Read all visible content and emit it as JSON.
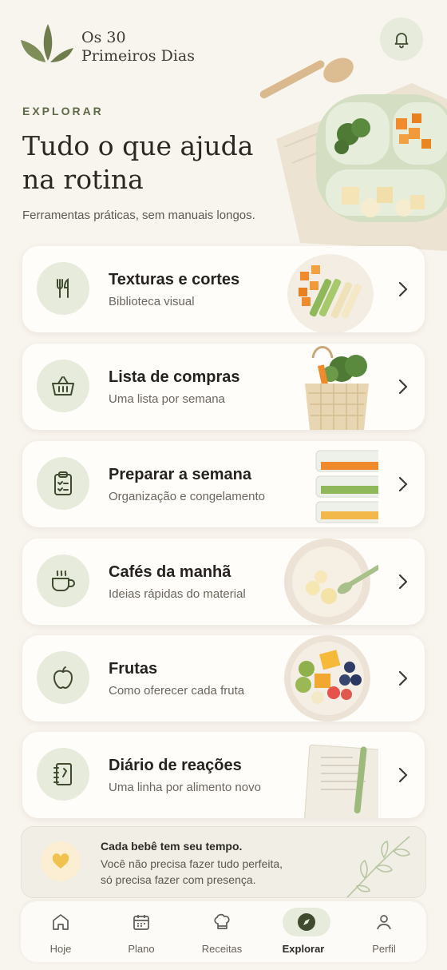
{
  "app": {
    "brand_line1": "Os 30",
    "brand_line2": "Primeiros Dias"
  },
  "colors": {
    "accent": "#5d6a47",
    "icon_bg": "#e6ebdc",
    "background": "#f8f4ee",
    "card": "#fffdfa"
  },
  "header": {
    "eyebrow": "EXPLORAR",
    "title_line1": "Tudo o que ajuda",
    "title_line2": "na rotina",
    "subtitle": "Ferramentas práticas, sem manuais longos.",
    "bell_icon": "bell-icon"
  },
  "cards": [
    {
      "title": "Texturas e cortes",
      "subtitle": "Biblioteca visual",
      "icon": "fork-knife-icon"
    },
    {
      "title": "Lista de compras",
      "subtitle": "Uma lista por semana",
      "icon": "basket-icon"
    },
    {
      "title": "Preparar a semana",
      "subtitle": "Organização e congelamento",
      "icon": "clipboard-icon"
    },
    {
      "title": "Cafés da manhã",
      "subtitle": "Ideias rápidas do material",
      "icon": "cup-icon"
    },
    {
      "title": "Frutas",
      "subtitle": "Como oferecer cada fruta",
      "icon": "apple-icon"
    },
    {
      "title": "Diário de reações",
      "subtitle": "Uma linha por alimento novo",
      "icon": "notebook-icon"
    }
  ],
  "quote": {
    "title": "Cada bebê tem seu tempo.",
    "line1": "Você não precisa fazer tudo perfeita,",
    "line2": "só precisa fazer com presença.",
    "icon": "heart-icon"
  },
  "nav": {
    "items": [
      {
        "label": "Hoje",
        "icon": "home-icon"
      },
      {
        "label": "Plano",
        "icon": "calendar-icon"
      },
      {
        "label": "Receitas",
        "icon": "chef-hat-icon"
      },
      {
        "label": "Explorar",
        "icon": "compass-icon",
        "active": true
      },
      {
        "label": "Perfil",
        "icon": "user-icon"
      }
    ]
  }
}
